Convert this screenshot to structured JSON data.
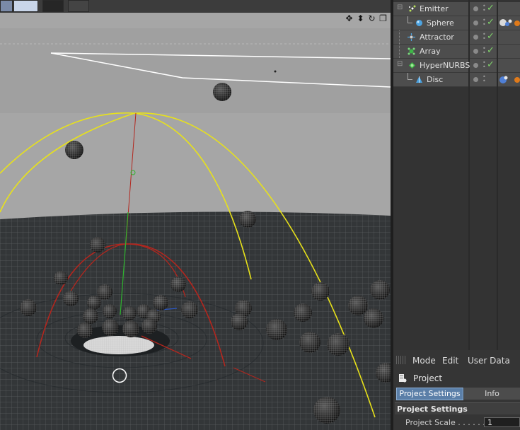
{
  "viewport": {
    "nav_icons": [
      "move-icon",
      "scale-icon",
      "rotate-icon",
      "maximize-icon"
    ],
    "nav_glyphs": [
      "✥",
      "⬍",
      "↻",
      "❐"
    ]
  },
  "object_manager": {
    "objects": [
      {
        "label": "Emitter",
        "icon": "emitter-icon",
        "indent": 0
      },
      {
        "label": "Sphere",
        "icon": "sphere-icon",
        "indent": 1
      },
      {
        "label": "Attractor",
        "icon": "attractor-icon",
        "indent": 0
      },
      {
        "label": "Array",
        "icon": "array-icon",
        "indent": 0
      },
      {
        "label": "HyperNURBS",
        "icon": "hypernurbs-icon",
        "indent": 0
      },
      {
        "label": "Disc",
        "icon": "disc-icon",
        "indent": 1
      }
    ]
  },
  "attributes": {
    "menu": {
      "mode": "Mode",
      "edit": "Edit",
      "user_data": "User Data"
    },
    "title": "Project",
    "tabs": {
      "active": "Project Settings",
      "other": "Info"
    },
    "section": "Project Settings",
    "field": {
      "label": "Project Scale . . . . . .",
      "value": "1"
    }
  },
  "colors": {
    "viewport_bg": "#9c9c9c",
    "panel_bg": "#4d4d4d",
    "accent_tab": "#5b7fa8",
    "spline_yellow": "#e8e21a",
    "spline_red": "#b3261e",
    "check_green": "#7fd16a"
  }
}
